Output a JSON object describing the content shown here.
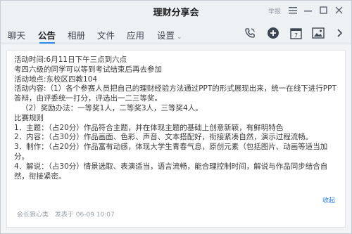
{
  "window": {
    "title": "理财分享会",
    "muted_label": "举报"
  },
  "tabs": [
    {
      "label": "聊天"
    },
    {
      "label": "公告"
    },
    {
      "label": "相册"
    },
    {
      "label": "文件"
    },
    {
      "label": "应用"
    },
    {
      "label": "设置"
    }
  ],
  "toolbar_icons": [
    "phone-icon",
    "add-icon",
    "calendar-icon",
    "image-icon"
  ],
  "announcement": {
    "lines": [
      "活动时间:6月11日下午三点到六点",
      "考四六级的同学可以等到考试结束后再去参加",
      "活动地点:东校区四教104",
      "活动内容:（1）各个参赛人员把自己的理财经验方法通过PPT的形式展现出来，统一在线下进行PPT答辩，由评委统一打分，评选出一二三等奖。",
      "（2）奖励办法：一等奖1人，二等奖3人，三等奖4人。",
      "比赛规则",
      "1．主题：（占20分）作品符合主题，并在体现主题的基础上创意新颖，有鲜明特色",
      "2．内容：（占30分）作品画面、色彩、声音、文本搭配好，衔接紧凑自然，演示过程流畅。",
      "3．制作：（占20分）作品富有动感，体现大学生青春气息，原创元素（包括图片、动画等适当加分。",
      "4．解说：（占30分）情景选取、表演适当，语言流畅，能合理控制时间，解说与作品同步结合自然，衔接紧密。"
    ],
    "collapse_label": "收起",
    "author": "会长狼心类",
    "posted_at": "发表于 06-09 10:07"
  },
  "colors": {
    "accent": "#2f8ef4",
    "link": "#2f80ed"
  }
}
